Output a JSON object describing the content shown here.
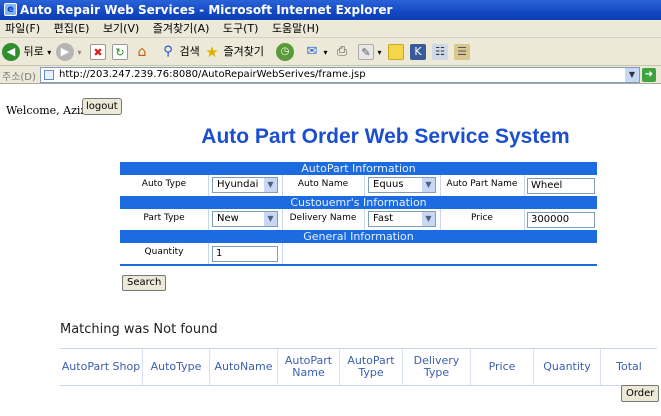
{
  "window": {
    "title": "Auto Repair Web Services - Microsoft Internet Explorer"
  },
  "menu": [
    "파일(F)",
    "편집(E)",
    "보기(V)",
    "즐겨찾기(A)",
    "도구(T)",
    "도움말(H)"
  ],
  "toolbar": {
    "back_label": "뒤로",
    "search_label": "검색",
    "favorites_label": "즐겨찾기"
  },
  "address": {
    "label": "주소(D)",
    "url": "http://203.247.239.76:8080/AutoRepairWebSerives/frame.jsp",
    "go_label": "0"
  },
  "page": {
    "welcome_text": "Welcome, Aziz",
    "logout_label": "logout",
    "title": "Auto Part Order Web Service System",
    "sections": {
      "autopart": "AutoPart Information",
      "customer": "Custouemr's Information",
      "general": "General Information"
    },
    "fields": {
      "auto_type_label": "Auto Type",
      "auto_type_value": "Hyundai",
      "auto_name_label": "Auto Name",
      "auto_name_value": "Equus",
      "part_name_label": "Auto Part Name",
      "part_name_value": "Wheel",
      "part_type_label": "Part Type",
      "part_type_value": "New",
      "delivery_label": "Delivery Name",
      "delivery_value": "Fast",
      "price_label": "Price",
      "price_value": "300000",
      "quantity_label": "Quantity",
      "quantity_value": "1"
    },
    "search_label": "Search",
    "status_text": "Matching was Not found",
    "result_columns": [
      "AutoPart Shop",
      "AutoType",
      "AutoName",
      "AutoPart Name",
      "AutoPart Type",
      "Delivery Type",
      "Price",
      "Quantity",
      "Total"
    ],
    "order_label": "Order"
  }
}
